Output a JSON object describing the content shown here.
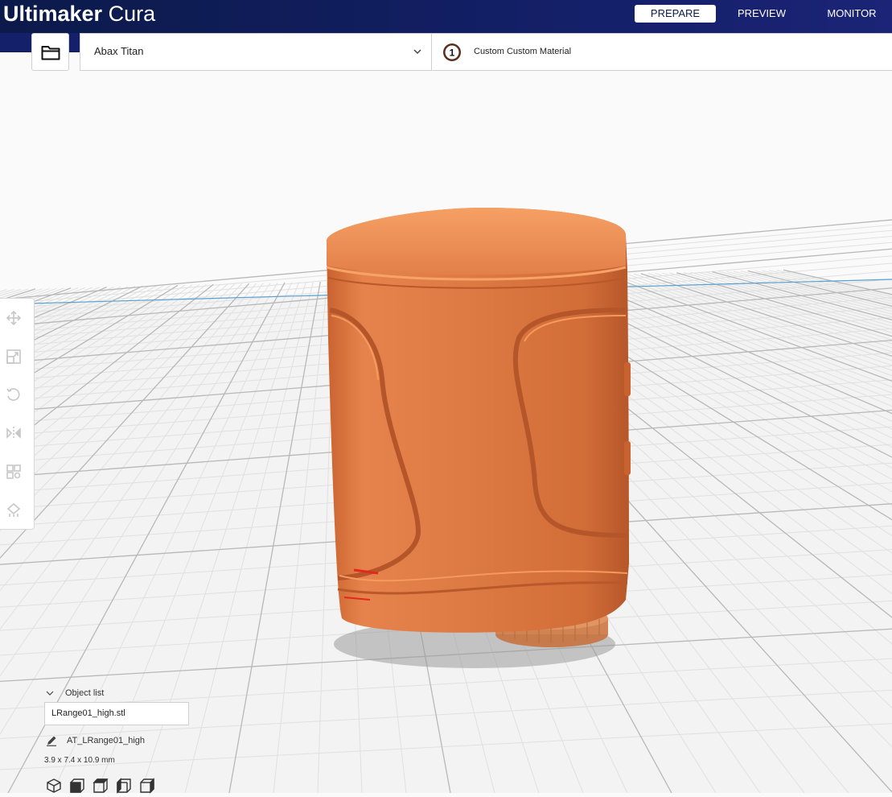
{
  "app": {
    "brand": "Ultimaker",
    "product": "Cura"
  },
  "nav": {
    "tabs": [
      {
        "label": "PREPARE",
        "active": true
      },
      {
        "label": "PREVIEW",
        "active": false
      },
      {
        "label": "MONITOR",
        "active": false
      }
    ]
  },
  "header": {
    "open_icon": "folder-icon",
    "printer": "Abax Titan",
    "extruder_number": "1",
    "material": "Custom Custom Material"
  },
  "toolbar": {
    "tools": [
      "move-icon",
      "scale-icon",
      "rotate-icon",
      "mirror-icon",
      "per-model-settings-icon",
      "support-blocker-icon"
    ]
  },
  "object_list": {
    "toggle_label": "Object list",
    "file": "LRange01_high.stl",
    "object_name": "AT_LRange01_high",
    "dimensions": "3.9 x 7.4 x 10.9 mm",
    "view_icons": [
      "3d-view-icon",
      "front-view-icon",
      "top-view-icon",
      "left-view-icon",
      "right-view-icon"
    ]
  },
  "colors": {
    "header_bg": "#15206b",
    "model": "#e07b45",
    "model_highlight": "#f59a5c",
    "build_plate": "#f7f7f7",
    "grid_line": "#c9c9c9"
  }
}
